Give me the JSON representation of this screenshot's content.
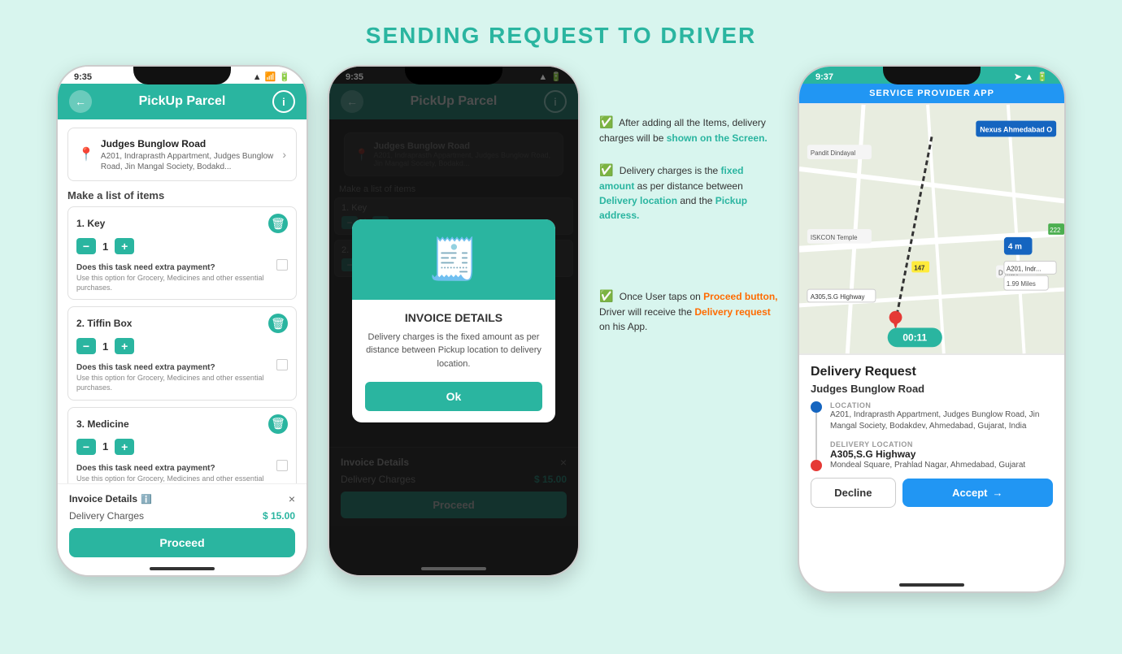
{
  "page": {
    "title": "SENDING REQUEST TO DRIVER",
    "bg_color": "#d8f5ee"
  },
  "phone1": {
    "status_time": "9:35",
    "header_title": "PickUp Parcel",
    "back_label": "←",
    "info_label": "i",
    "address_title": "Judges Bunglow Road",
    "address_sub": "A201, Indraprasth Appartment, Judges Bunglow Road, Jin Mangal Society, Bodakd...",
    "section_title": "Make a list of items",
    "items": [
      {
        "num": "1.",
        "name": "Key",
        "qty": "1"
      },
      {
        "num": "2.",
        "name": "Tiffin Box",
        "qty": "1"
      },
      {
        "num": "3.",
        "name": "Medicine",
        "qty": "1"
      }
    ],
    "extra_payment_label": "Does this task need extra payment?",
    "extra_payment_sub": "Use this option for Grocery, Medicines and other essential purchases.",
    "invoice_title": "Invoice Details",
    "invoice_info": "ℹ",
    "delivery_charge_label": "Delivery Charges",
    "delivery_charge_val": "$ 15.00",
    "proceed_label": "Proceed",
    "close_label": "×"
  },
  "phone2": {
    "status_time": "9:35",
    "header_title": "PickUp Parcel",
    "invoice_title": "Invoice Details",
    "delivery_charge_label": "Delivery Charges",
    "delivery_charge_val": "$ 15.00",
    "proceed_label": "Proceed",
    "modal": {
      "title": "INVOICE DETAILS",
      "desc": "Delivery charges is the fixed amount as per distance between Pickup location to delivery location.",
      "ok_label": "Ok"
    }
  },
  "annotations": {
    "a1_text1": "After adding all the Items, delivery charges will be shown on the Screen.",
    "a1_text2": "Delivery charges is the fixed amount as per distance between Delivery location and the Pickup address.",
    "a2_text": "Once User taps on Proceed button, Driver will receive the Delivery request on his App."
  },
  "phone3": {
    "status_time": "9:37",
    "header_title": "SERVICE PROVIDER APP",
    "map_badge": "4 m",
    "map_distance": "1.99 Miles",
    "timer": "00:11",
    "dr_title": "Delivery Request",
    "dr_subtitle": "Judges Bunglow Road",
    "location_label": "LOCATION",
    "location_addr": "A201, Indraprasth Appartment, Judges Bunglow Road, Jin Mangal Society, Bodakdev, Ahmedabad, Gujarat, India",
    "delivery_loc_label": "DELIVERY LOCATION",
    "delivery_loc_name": "A305,S.G Highway",
    "delivery_loc_addr": "Mondeal Square, Prahlad Nagar, Ahmedabad, Gujarat",
    "decline_label": "Decline",
    "accept_label": "Accept"
  }
}
